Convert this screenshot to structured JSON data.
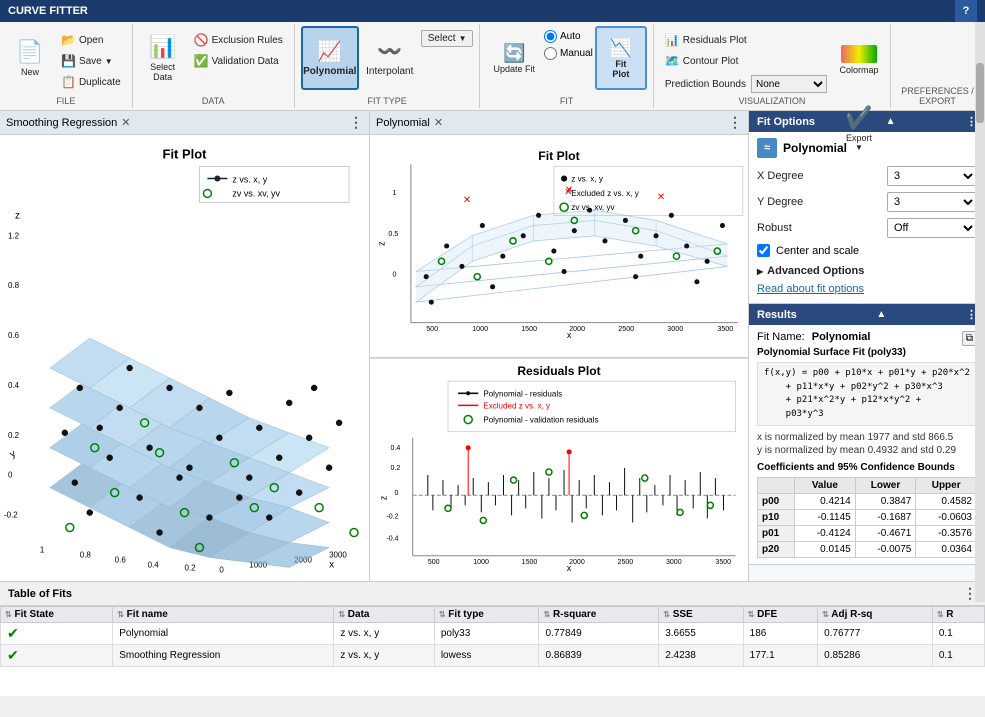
{
  "titleBar": {
    "title": "CURVE FITTER",
    "helpBtn": "?"
  },
  "ribbon": {
    "groups": {
      "file": {
        "label": "FILE",
        "new": "New",
        "open": "Open",
        "save": "Save",
        "duplicate": "Duplicate"
      },
      "data": {
        "label": "DATA",
        "exclusionRules": "Exclusion Rules",
        "validationData": "Validation Data",
        "selectData": "Select\nData"
      },
      "fitType": {
        "label": "FIT TYPE",
        "polynomial": "Polynomial",
        "interpolant": "Interpolant",
        "selectLabel": "Select"
      },
      "fit": {
        "label": "FIT",
        "updateFit": "Update Fit",
        "auto": "Auto",
        "manual": "Manual",
        "fitPlot": "Fit\nPlot"
      },
      "visualization": {
        "label": "VISUALIZATION",
        "residualsPlot": "Residuals Plot",
        "contourPlot": "Contour Plot",
        "predictionBounds": "Prediction Bounds",
        "predictionBoundsValue": "None",
        "colormap": "Colormap",
        "export": "Export"
      },
      "preferences": {
        "label": "PREFERENCES"
      },
      "exportGroup": {
        "label": "EXPORT"
      }
    }
  },
  "panels": {
    "left": {
      "title": "Smoothing Regression",
      "plotTitle": "Fit Plot",
      "legend": {
        "line1": "z vs. x, y",
        "line2": "zv vs. xv, yv"
      }
    },
    "right": {
      "title": "Polynomial",
      "topPlot": {
        "title": "Fit Plot",
        "legend": {
          "item1": "z vs. x, y",
          "item2": "Excluded z vs. x, y",
          "item3": "zv vs. xv, yv"
        },
        "xLabel": "x",
        "zLabel": "z"
      },
      "bottomPlot": {
        "title": "Residuals Plot",
        "legend": {
          "item1": "Polynomial - residuals",
          "item2": "Excluded z vs. x, y",
          "item3": "Polynomial - validation residuals"
        },
        "xLabel": "x",
        "zLabel": "z",
        "xTickMin": "500",
        "xTickMax": "3500"
      }
    }
  },
  "fitOptions": {
    "sectionTitle": "Fit Options",
    "fitType": "Polynomial",
    "xDegree": {
      "label": "X Degree",
      "value": "3"
    },
    "yDegree": {
      "label": "Y Degree",
      "value": "3"
    },
    "robust": {
      "label": "Robust",
      "value": "Off"
    },
    "centerAndScale": {
      "label": "Center and scale",
      "checked": true
    },
    "advancedOptions": "Advanced Options",
    "readLink": "Read about fit options"
  },
  "results": {
    "sectionTitle": "Results",
    "fitName": {
      "label": "Fit Name:",
      "value": "Polynomial"
    },
    "formula": "f(x,y) = p00 + p10*x + p01*y + p20*x^2\n    + p11*x*y + p02*y^2 + p30*x^3\n    + p21*x^2*y + p12*x*y^2 +\n    p03*y^3",
    "normalizeX": "x is normalized by mean 1977 and std 866.5",
    "normalizeY": "y is normalized by mean 0.4932 and std 0.29",
    "coeffLabel": "Coefficients and 95% Confidence Bounds",
    "coeffTable": {
      "headers": [
        "",
        "Value",
        "Lower",
        "Upper"
      ],
      "rows": [
        {
          "name": "p00",
          "value": "0.4214",
          "lower": "0.3847",
          "upper": "0.4582"
        },
        {
          "name": "p10",
          "value": "-0.1145",
          "lower": "-0.1687",
          "upper": "-0.0603"
        },
        {
          "name": "p01",
          "value": "-0.4124",
          "lower": "-0.4671",
          "upper": "-0.3576"
        },
        {
          "name": "p20",
          "value": "0.0145",
          "lower": "-0.0075",
          "upper": "0.0364"
        }
      ]
    }
  },
  "bottomTable": {
    "title": "Table of Fits",
    "columns": [
      "Fit State",
      "Fit name",
      "Data",
      "Fit type",
      "R-square",
      "SSE",
      "DFE",
      "Adj R-sq",
      "R"
    ],
    "rows": [
      {
        "state": "✓",
        "name": "Polynomial",
        "data": "z vs. x, y",
        "fitType": "poly33",
        "rSquare": "0.77849",
        "sse": "3.6655",
        "dfe": "186",
        "adjRSq": "0.76777",
        "r": "0.1"
      },
      {
        "state": "✓",
        "name": "Smoothing Regression",
        "data": "z vs. x, y",
        "fitType": "lowess",
        "rSquare": "0.86839",
        "sse": "2.4238",
        "dfe": "177.1",
        "adjRSq": "0.85286",
        "r": "0.1"
      }
    ]
  }
}
